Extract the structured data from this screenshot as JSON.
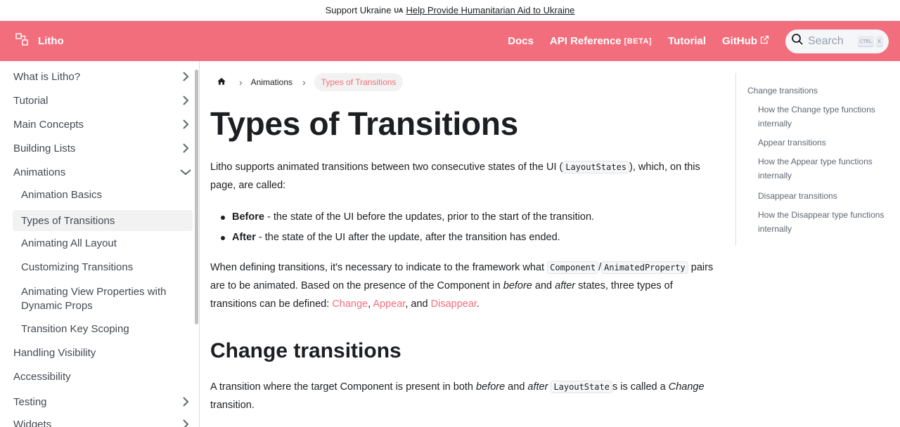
{
  "banner": {
    "text": "Support Ukraine",
    "flag": "UA",
    "link": "Help Provide Humanitarian Aid to Ukraine"
  },
  "navbar": {
    "brand": "Litho",
    "links": [
      "Docs",
      "API Reference",
      "Tutorial",
      "GitHub"
    ],
    "beta": "[BETA]",
    "search_placeholder": "Search",
    "kbd_ctrl": "CTRL",
    "kbd_k": "K",
    "accent": "#f36e7d"
  },
  "sidebar": {
    "items": [
      {
        "label": "What is Litho?",
        "chevron": "right"
      },
      {
        "label": "Tutorial",
        "chevron": "right"
      },
      {
        "label": "Main Concepts",
        "chevron": "right"
      },
      {
        "label": "Building Lists",
        "chevron": "right"
      },
      {
        "label": "Animations",
        "chevron": "down"
      },
      {
        "label": "Animation Basics"
      },
      {
        "label": "Types of Transitions",
        "active": true
      },
      {
        "label": "Animating All Layout"
      },
      {
        "label": "Customizing Transitions"
      },
      {
        "label": "Animating View Properties with Dynamic Props"
      },
      {
        "label": "Transition Key Scoping"
      },
      {
        "label": "Handling Visibility"
      },
      {
        "label": "Accessibility"
      },
      {
        "label": "Testing",
        "chevron": "right"
      },
      {
        "label": "Widgets",
        "chevron": "right"
      }
    ]
  },
  "breadcrumb": {
    "items": [
      "Animations",
      "Types of Transitions"
    ]
  },
  "content": {
    "title": "Types of Transitions",
    "p1_a": "Litho supports animated transitions between two consecutive states of the UI (",
    "p1_code": "LayoutStates",
    "p1_b": "), which, on this page, are called:",
    "bullet1_b": "Before",
    "bullet1_t": " - the state of the UI before the updates, prior to the start of the transition.",
    "bullet2_b": "After",
    "bullet2_t": " - the state of the UI after the update, after the transition has ended.",
    "p2_a": "When defining transitions, it's necessary to indicate to the framework what ",
    "p2_code1": "Component",
    "p2_slash": "/",
    "p2_code2": "AnimatedProperty",
    "p2_b": " pairs are to be animated. Based on the presence of the Component in ",
    "p2_before": "before",
    "p2_and": " and ",
    "p2_after": "after",
    "p2_c": " states, three types of transitions can be defined: ",
    "p2_link1": "Change",
    "p2_comma": ", ",
    "p2_link2": "Appear",
    "p2_andlink": ", and ",
    "p2_link3": "Disappear",
    "p2_end": ".",
    "h2": "Change transitions",
    "p3_a": "A transition where the target Component is present in both ",
    "p3_before": "before",
    "p3_and": " and ",
    "p3_after": "after",
    "p3_space": " ",
    "p3_code": "LayoutState",
    "p3_b": "s is called a ",
    "p3_change": "Change",
    "p3_c": " transition."
  },
  "toc": {
    "items": [
      "Change transitions",
      "How the Change type functions internally",
      "Appear transitions",
      "How the Appear type functions internally",
      "Disappear transitions",
      "How the Disappear type functions internally"
    ]
  }
}
